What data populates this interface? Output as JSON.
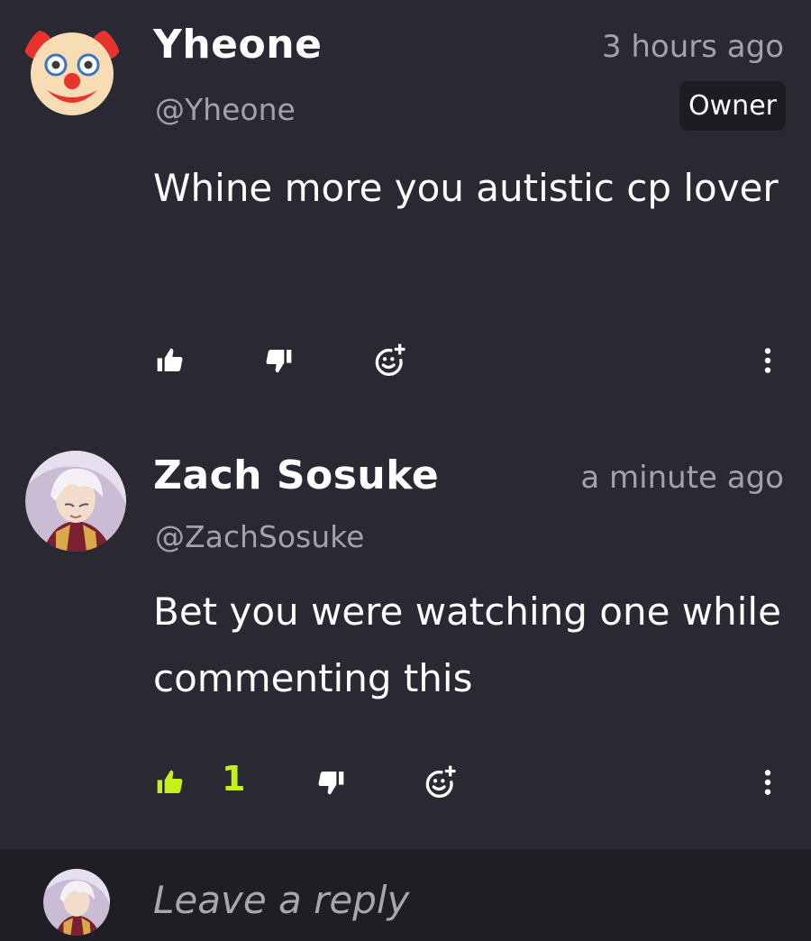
{
  "comments": [
    {
      "username": "Yheone",
      "handle": "@Yheone",
      "time": "3 hours ago",
      "badge": "Owner",
      "text": "Whine more you autistic cp lover",
      "avatar": "clown-emoji",
      "likes": "",
      "liked": false
    },
    {
      "username": "Zach Sosuke",
      "handle": "@ZachSosuke",
      "time": "a minute ago",
      "text": "Bet you were watching one while commenting this",
      "avatar": "anime-character",
      "likes": "1",
      "liked": true
    }
  ],
  "reply": {
    "placeholder": "Leave a reply"
  },
  "icons": {
    "like": "thumbs-up-icon",
    "dislike": "thumbs-down-icon",
    "react": "add-reaction-icon",
    "more": "more-vertical-icon"
  },
  "colors": {
    "background": "#2a2832",
    "reply_bar": "#1f1e25",
    "accent_liked": "#c5f01a",
    "muted_text": "#a3a2aa"
  }
}
